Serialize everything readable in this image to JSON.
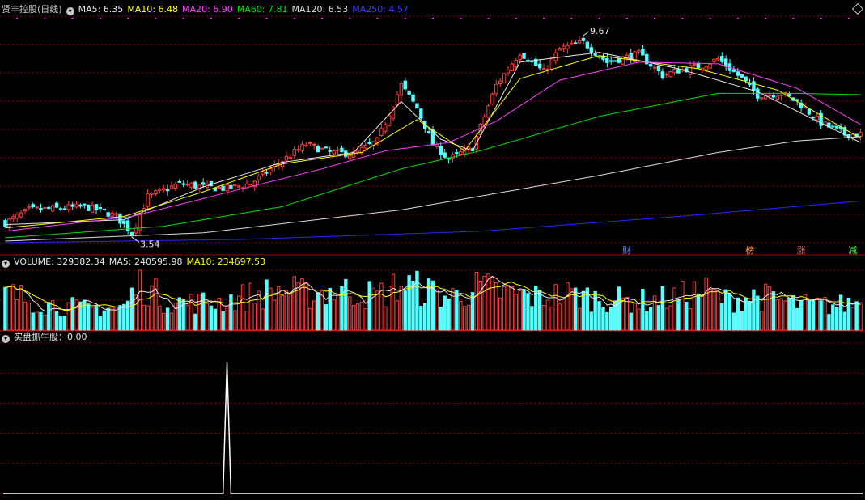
{
  "colors": {
    "up": "#ff3c3c",
    "down": "#54ffff",
    "ma5": "#e8e8e8",
    "ma10": "#ffff00",
    "ma20": "#ff40ff",
    "ma60": "#00e000",
    "ma120": "#dcdcdc",
    "ma250": "#2828ff",
    "grid": "#8b0000",
    "signal": "#ffffff"
  },
  "price_panel": {
    "stock_name": "贤丰控股(日线)",
    "ma_labels": [
      {
        "key": "ma5",
        "text": "MA5: 6.35"
      },
      {
        "key": "ma10",
        "text": "MA10: 6.48"
      },
      {
        "key": "ma20",
        "text": "MA20: 6.90"
      },
      {
        "key": "ma60",
        "text": "MA60: 7.81"
      },
      {
        "key": "ma120",
        "text": "MA120: 6.53"
      },
      {
        "key": "ma250",
        "text": "MA250: 4.57"
      }
    ],
    "high_label": "9.67",
    "low_label": "3.54",
    "event_tags": [
      {
        "text": "财",
        "color": "#5aa0ff"
      },
      {
        "text": "榜",
        "color": "#ff9040"
      },
      {
        "text": "涨",
        "color": "#ff5050"
      },
      {
        "text": "减",
        "color": "#40ff40"
      }
    ]
  },
  "volume_panel": {
    "labels": [
      {
        "key": "vol",
        "text": "VOLUME: 329382.34"
      },
      {
        "key": "ma5",
        "text": "MA5: 240595.98"
      },
      {
        "key": "ma10",
        "text": "MA10: 234697.53"
      }
    ]
  },
  "indicator_panel": {
    "label": "实盘抓牛股：0.00"
  },
  "chart_data": {
    "type": "candlestick",
    "ylim": [
      3.3,
      10.2
    ],
    "price_anchors": [
      [
        0,
        3.9
      ],
      [
        6,
        4.3
      ],
      [
        14,
        4.35
      ],
      [
        20,
        4.4
      ],
      [
        25,
        4.25
      ],
      [
        28,
        4.1
      ],
      [
        32,
        3.6
      ],
      [
        36,
        4.7
      ],
      [
        44,
        5.1
      ],
      [
        50,
        5.0
      ],
      [
        56,
        4.95
      ],
      [
        62,
        5.1
      ],
      [
        70,
        5.8
      ],
      [
        76,
        6.3
      ],
      [
        82,
        6.05
      ],
      [
        88,
        6.0
      ],
      [
        94,
        6.4
      ],
      [
        100,
        8.1
      ],
      [
        104,
        7.4
      ],
      [
        108,
        6.3
      ],
      [
        112,
        5.85
      ],
      [
        118,
        6.2
      ],
      [
        124,
        8.1
      ],
      [
        130,
        9.1
      ],
      [
        136,
        8.5
      ],
      [
        140,
        9.2
      ],
      [
        146,
        9.4
      ],
      [
        152,
        8.8
      ],
      [
        160,
        9.05
      ],
      [
        166,
        8.4
      ],
      [
        170,
        8.55
      ],
      [
        176,
        8.7
      ],
      [
        180,
        8.9
      ],
      [
        186,
        8.3
      ],
      [
        190,
        7.8
      ],
      [
        196,
        7.85
      ],
      [
        200,
        7.6
      ],
      [
        206,
        6.95
      ],
      [
        212,
        6.6
      ],
      [
        216,
        6.6
      ]
    ],
    "ma_anchors": {
      "ma5": [
        [
          0,
          3.85
        ],
        [
          30,
          4.0
        ],
        [
          50,
          5.0
        ],
        [
          70,
          5.75
        ],
        [
          88,
          6.05
        ],
        [
          100,
          7.6
        ],
        [
          110,
          6.45
        ],
        [
          118,
          6.1
        ],
        [
          130,
          8.8
        ],
        [
          150,
          9.1
        ],
        [
          170,
          8.6
        ],
        [
          190,
          7.9
        ],
        [
          216,
          6.35
        ]
      ],
      "ma10": [
        [
          0,
          3.75
        ],
        [
          30,
          4.1
        ],
        [
          50,
          4.85
        ],
        [
          70,
          5.7
        ],
        [
          90,
          6.05
        ],
        [
          104,
          7.05
        ],
        [
          116,
          6.1
        ],
        [
          130,
          8.3
        ],
        [
          150,
          9.0
        ],
        [
          175,
          8.6
        ],
        [
          195,
          7.95
        ],
        [
          216,
          6.48
        ]
      ],
      "ma20": [
        [
          0,
          3.65
        ],
        [
          32,
          4.1
        ],
        [
          60,
          4.95
        ],
        [
          80,
          5.55
        ],
        [
          96,
          6.1
        ],
        [
          112,
          6.35
        ],
        [
          124,
          7.0
        ],
        [
          140,
          8.25
        ],
        [
          160,
          8.8
        ],
        [
          180,
          8.75
        ],
        [
          200,
          8.0
        ],
        [
          216,
          6.9
        ]
      ],
      "ma60": [
        [
          0,
          3.45
        ],
        [
          40,
          3.8
        ],
        [
          70,
          4.4
        ],
        [
          100,
          5.55
        ],
        [
          120,
          6.1
        ],
        [
          150,
          7.15
        ],
        [
          180,
          7.85
        ],
        [
          200,
          7.85
        ],
        [
          216,
          7.81
        ]
      ],
      "ma120": [
        [
          0,
          3.35
        ],
        [
          50,
          3.6
        ],
        [
          100,
          4.3
        ],
        [
          150,
          5.35
        ],
        [
          180,
          6.05
        ],
        [
          200,
          6.4
        ],
        [
          216,
          6.53
        ]
      ],
      "ma250": [
        [
          0,
          3.3
        ],
        [
          60,
          3.4
        ],
        [
          120,
          3.65
        ],
        [
          170,
          4.1
        ],
        [
          216,
          4.57
        ]
      ]
    },
    "volume_ylim": [
      0,
      420000
    ],
    "volume_anchors": [
      [
        0,
        260000
      ],
      [
        10,
        185000
      ],
      [
        20,
        150000
      ],
      [
        30,
        160000
      ],
      [
        34,
        330000
      ],
      [
        40,
        210000
      ],
      [
        46,
        190000
      ],
      [
        54,
        200000
      ],
      [
        60,
        230000
      ],
      [
        70,
        280000
      ],
      [
        76,
        250000
      ],
      [
        84,
        280000
      ],
      [
        94,
        240000
      ],
      [
        100,
        320000
      ],
      [
        106,
        280000
      ],
      [
        112,
        230000
      ],
      [
        120,
        300000
      ],
      [
        126,
        260000
      ],
      [
        134,
        230000
      ],
      [
        142,
        250000
      ],
      [
        150,
        220000
      ],
      [
        160,
        200000
      ],
      [
        170,
        230000
      ],
      [
        176,
        280000
      ],
      [
        182,
        210000
      ],
      [
        190,
        240000
      ],
      [
        200,
        180000
      ],
      [
        210,
        170000
      ],
      [
        216,
        200000
      ]
    ],
    "signal_peak_index": 56,
    "signal_ylim": [
      0,
      1.15
    ]
  }
}
